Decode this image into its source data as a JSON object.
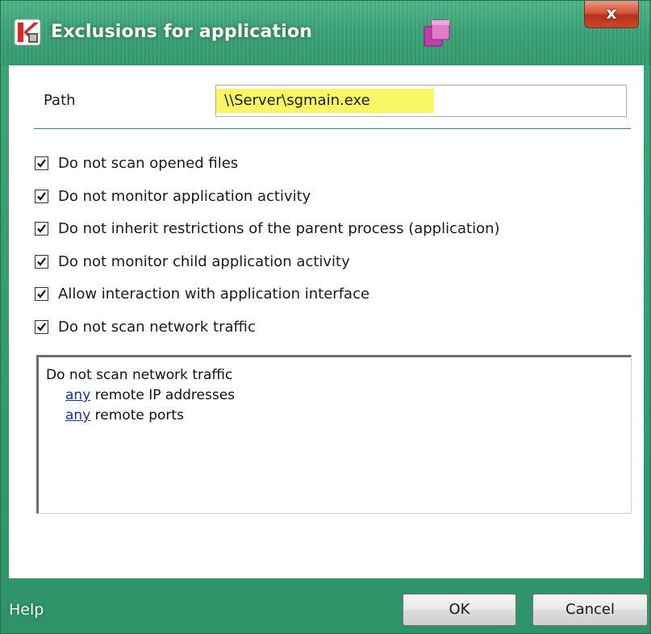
{
  "window": {
    "title": "Exclusions for application",
    "close_glyph": "x",
    "accent_color": "#3aa077",
    "icons": [
      "kaspersky-k-icon",
      "window-stack-icon",
      "close-icon"
    ]
  },
  "form": {
    "path_label": "Path",
    "path_value": "\\\\Server\\sgmain.exe",
    "highlight_color": "#fbf764"
  },
  "options": [
    {
      "label": "Do not scan opened files",
      "checked": true
    },
    {
      "label": "Do not monitor application activity",
      "checked": true
    },
    {
      "label": "Do not inherit restrictions of the parent process (application)",
      "checked": true
    },
    {
      "label": "Do not monitor child application activity",
      "checked": true
    },
    {
      "label": "Allow interaction with application interface",
      "checked": true
    },
    {
      "label": "Do not scan network traffic",
      "checked": true
    }
  ],
  "details": {
    "title": "Do not scan network traffic",
    "lines": [
      {
        "link": "any",
        "text": " remote IP addresses"
      },
      {
        "link": "any",
        "text": " remote ports"
      }
    ]
  },
  "footer": {
    "help_label": "Help",
    "ok_label": "OK",
    "cancel_label": "Cancel"
  }
}
